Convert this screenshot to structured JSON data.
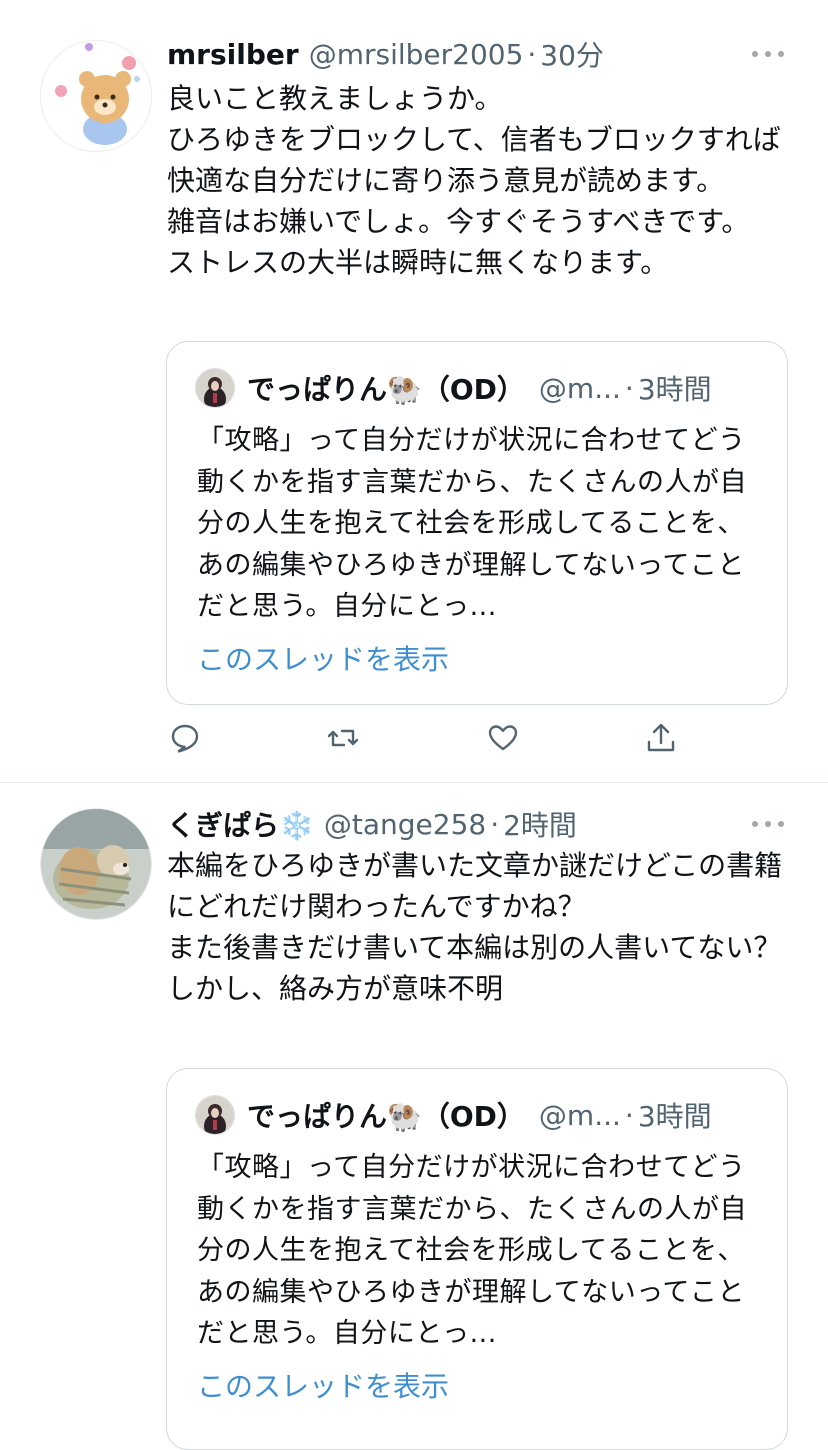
{
  "tweets": [
    {
      "name": "mrsilber",
      "handle": "@mrsilber2005",
      "sep": "·",
      "time": "30分",
      "text": "良いこと教えましょうか。\nひろゆきをブロックして、信者もブロックすれば快適な自分だけに寄り添う意見が読めます。\n雑音はお嫌いでしょ。今すぐそうすべきです。\nストレスの大半は瞬時に無くなります。",
      "avatar_icon": "bear-avatar",
      "quote": {
        "name": "でっぱりん🐏（OD）",
        "handle": "@m...",
        "sep": "·",
        "time": "3時間",
        "text": "「攻略」って自分だけが状況に合わせてどう動くかを指す言葉だから、たくさんの人が自分の人生を抱えて社会を形成してることを、あの編集やひろゆきが理解してないってことだと思う。自分にとっ...",
        "link": "このスレッドを表示"
      },
      "actions": [
        "reply-icon",
        "retweet-icon",
        "like-icon",
        "share-icon"
      ]
    },
    {
      "name": "くぎぱら❄️",
      "handle": "@tange258",
      "sep": "·",
      "time": "2時間",
      "text": "本編をひろゆきが書いた文章か謎だけどこの書籍にどれだけ関わったんですかね？\nまた後書きだけ書いて本編は別の人書いてない？\nしかし、絡み方が意味不明",
      "avatar_icon": "dog-avatar",
      "quote": {
        "name": "でっぱりん🐏（OD）",
        "handle": "@m...",
        "sep": "·",
        "time": "3時間",
        "text": "「攻略」って自分だけが状況に合わせてどう動くかを指す言葉だから、たくさんの人が自分の人生を抱えて社会を形成してることを、あの編集やひろゆきが理解してないってことだと思う。自分にとっ...",
        "link": "このスレッドを表示"
      }
    }
  ]
}
